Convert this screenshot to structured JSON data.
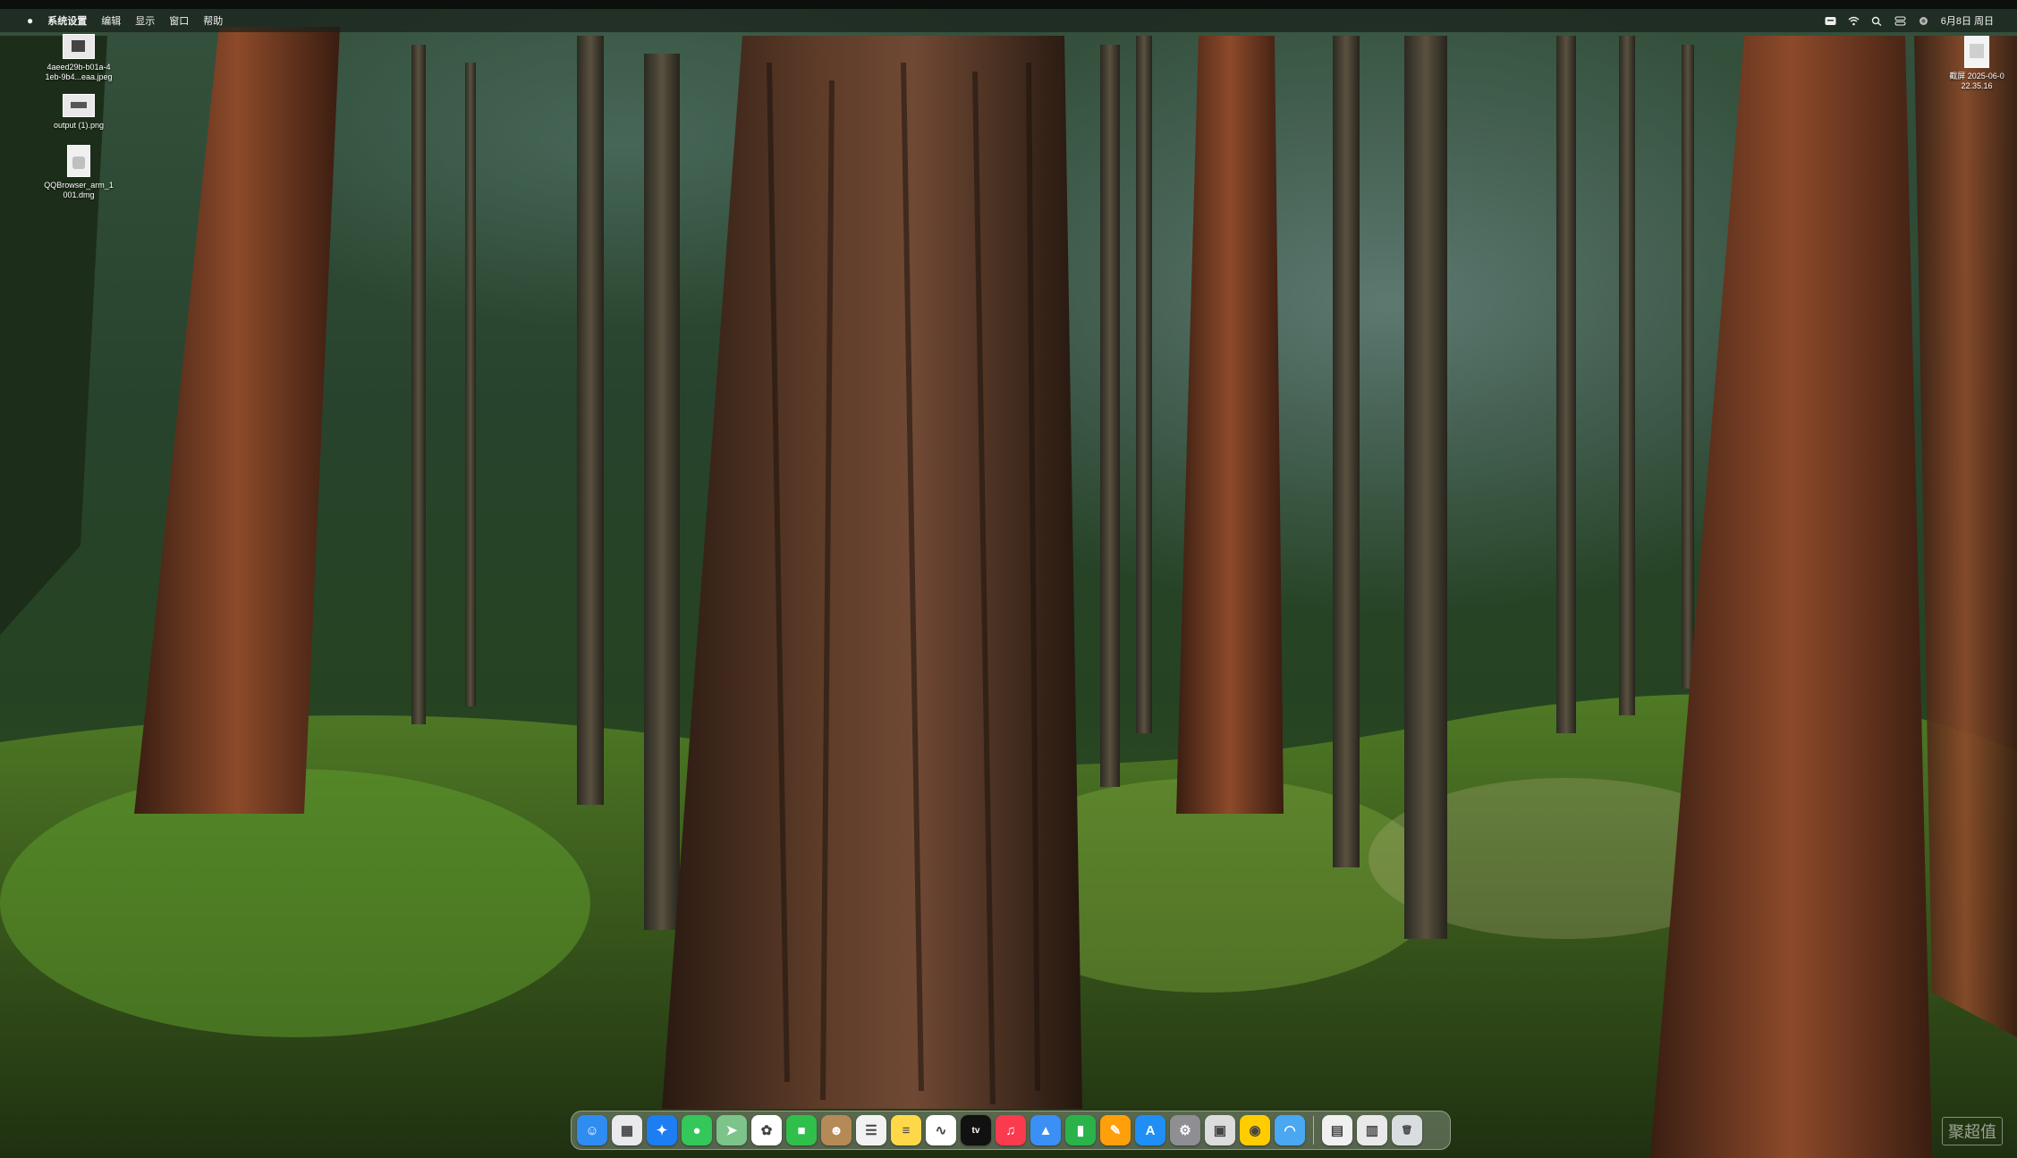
{
  "menubar": {
    "app_name": "系统设置",
    "items": [
      "编辑",
      "显示",
      "窗口",
      "帮助"
    ],
    "status_icons": [
      "input-method-icon",
      "wifi-icon",
      "search-icon",
      "control-center-icon",
      "siri-icon"
    ],
    "clock": "6月8日 周日"
  },
  "desktop": {
    "items": [
      {
        "label": "4aeed29b-b01a-4\n1eb-9b4...eaa.jpeg",
        "icon": "image-file-icon"
      },
      {
        "label": "output (1).png",
        "icon": "image-file-icon"
      },
      {
        "label": "QQBrowser_arm_1\n001.dmg",
        "icon": "disk-image-icon"
      },
      {
        "label": "截屏 2025-06-0\n22.35.16",
        "icon": "screenshot-file-icon"
      }
    ]
  },
  "dock": {
    "apps": [
      {
        "name": "Finder",
        "icon": "finder-icon",
        "color": "#2f8cf0",
        "glyph": "☺"
      },
      {
        "name": "Launchpad",
        "icon": "launchpad-icon",
        "color": "#e9e9ee",
        "glyph": "▦"
      },
      {
        "name": "Safari",
        "icon": "safari-icon",
        "color": "#1d7df2",
        "glyph": "✦"
      },
      {
        "name": "Messages",
        "icon": "messages-icon",
        "color": "#34c759",
        "glyph": "●"
      },
      {
        "name": "Maps",
        "icon": "maps-icon",
        "color": "#7cc48a",
        "glyph": "➤"
      },
      {
        "name": "Photos",
        "icon": "photos-icon",
        "color": "#ffffff",
        "glyph": "✿"
      },
      {
        "name": "FaceTime",
        "icon": "facetime-icon",
        "color": "#2fbf4a",
        "glyph": "■"
      },
      {
        "name": "Contacts",
        "icon": "contacts-icon",
        "color": "#b58a56",
        "glyph": "☻"
      },
      {
        "name": "Reminders",
        "icon": "reminders-icon",
        "color": "#f2f2f2",
        "glyph": "☰"
      },
      {
        "name": "Notes",
        "icon": "notes-icon",
        "color": "#ffd84a",
        "glyph": "≡"
      },
      {
        "name": "Freeform",
        "icon": "freeform-icon",
        "color": "#ffffff",
        "glyph": "∿"
      },
      {
        "name": "TV",
        "icon": "tv-icon",
        "color": "#111111",
        "glyph": "tv"
      },
      {
        "name": "Music",
        "icon": "music-icon",
        "color": "#fa3a4e",
        "glyph": "♫"
      },
      {
        "name": "Keynote",
        "icon": "keynote-icon",
        "color": "#3b8ff5",
        "glyph": "▲"
      },
      {
        "name": "Numbers",
        "icon": "numbers-icon",
        "color": "#29b34a",
        "glyph": "▮"
      },
      {
        "name": "Pages",
        "icon": "pages-icon",
        "color": "#ff9f0a",
        "glyph": "✎"
      },
      {
        "name": "App Store",
        "icon": "app-store-icon",
        "color": "#1f8ef5",
        "glyph": "A"
      },
      {
        "name": "System Settings",
        "icon": "settings-icon",
        "color": "#8e8e93",
        "glyph": "⚙"
      },
      {
        "name": "Preview",
        "icon": "preview-icon",
        "color": "#dcdcdc",
        "glyph": "▣"
      },
      {
        "name": "Tips",
        "icon": "tips-icon",
        "color": "#ffcc00",
        "glyph": "◉"
      },
      {
        "name": "QQ Browser",
        "icon": "browser-icon",
        "color": "#4aa7f2",
        "glyph": "◠"
      }
    ],
    "recents": [
      {
        "name": "Folder",
        "icon": "folder-stack-icon",
        "color": "#f0f0f0",
        "glyph": "▤"
      },
      {
        "name": "Downloads",
        "icon": "downloads-stack-icon",
        "color": "#e9e9e9",
        "glyph": "▥"
      },
      {
        "name": "Trash",
        "icon": "trash-icon",
        "color": "#d9dde0",
        "glyph": "🗑"
      }
    ]
  },
  "watermark": "聚超值"
}
